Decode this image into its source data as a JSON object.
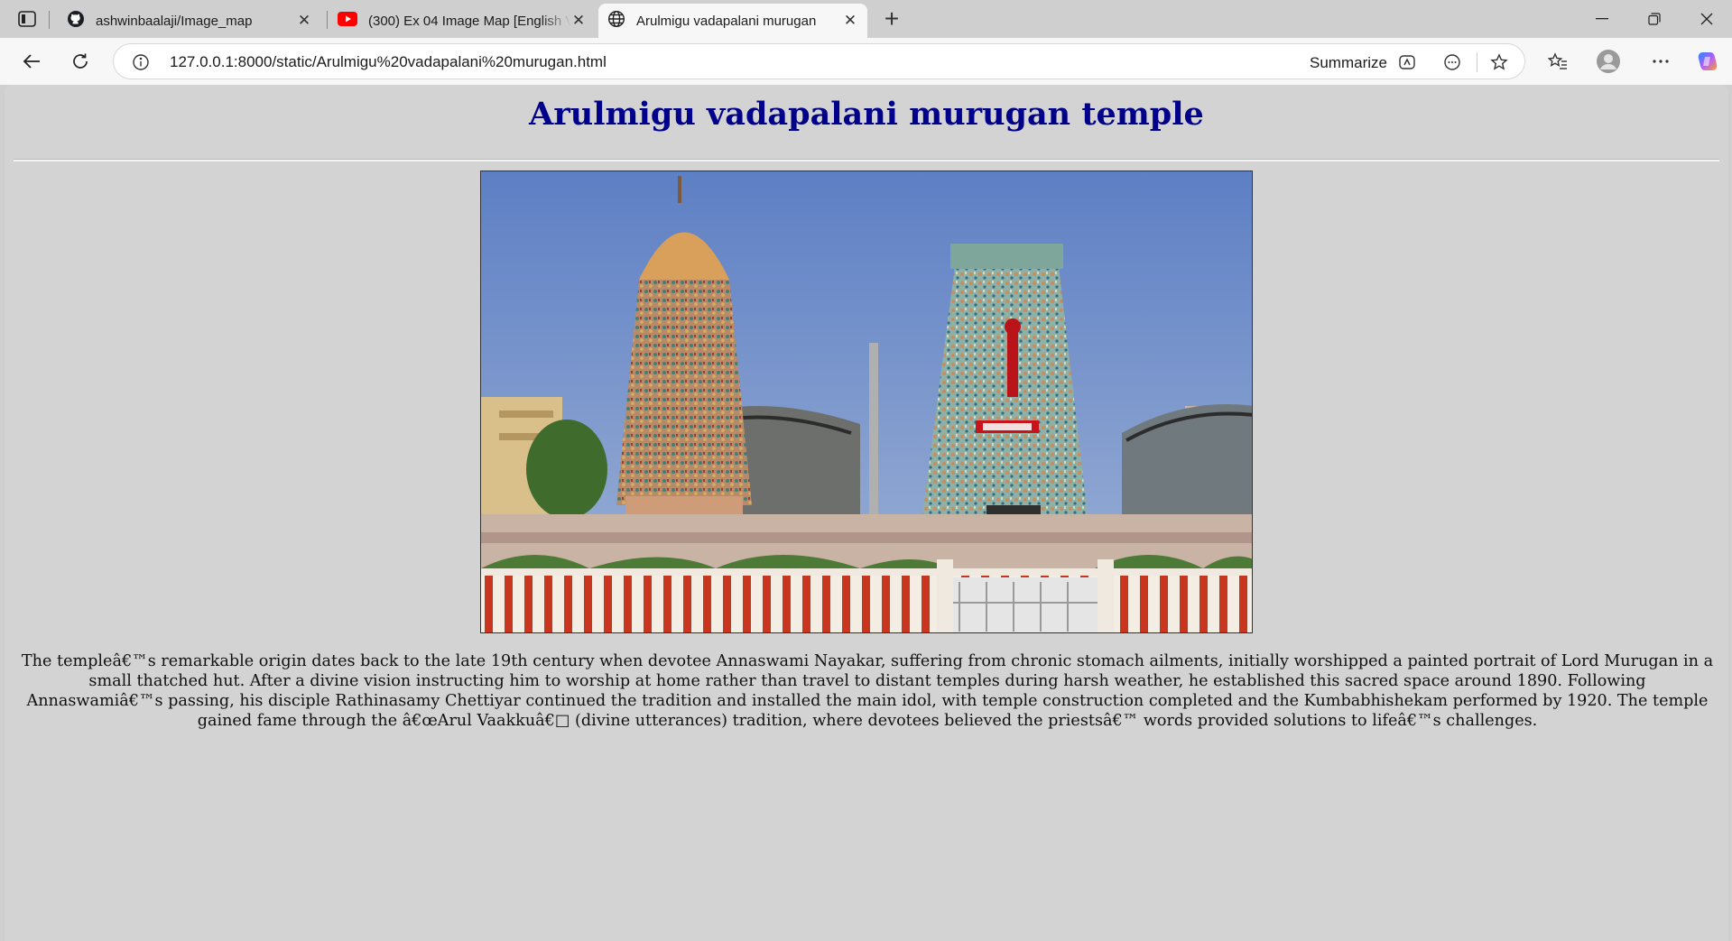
{
  "browser": {
    "tabs": [
      {
        "title": "ashwinbaalaji/Image_map",
        "icon": "github-icon"
      },
      {
        "title": "(300) Ex 04 Image Map [English Ve",
        "icon": "youtube-icon"
      },
      {
        "title": "Arulmigu vadapalani murugan",
        "icon": "globe-icon",
        "active": true
      }
    ],
    "url": "127.0.0.1:8000/static/Arulmigu%20vadapalani%20murugan.html",
    "summarize_label": "Summarize"
  },
  "page": {
    "title": "Arulmigu vadapalani murugan temple",
    "image_alt": "Arulmigu Vadapalani Murugan Temple gopurams",
    "description": "The templeâ€™s remarkable origin dates back to the late 19th century when devotee Annaswami Nayakar, suffering from chronic stomach ailments, initially worshipped a painted portrait of Lord Murugan in a small thatched hut. After a divine vision instructing him to worship at home rather than travel to distant temples during harsh weather, he established this sacred space around 1890. Following Annaswamiâ€™s passing, his disciple Rathinasamy Chettiyar continued the tradition and installed the main idol, with temple construction completed and the Kumbabhishekam performed by 1920. The temple gained fame through the â€œArul Vaakkuâ€□ (divine utterances) tradition, where devotees believed the priestsâ€™ words provided solutions to lifeâ€™s challenges."
  },
  "colors": {
    "title": "#00008b",
    "page_background": "#d3d3d3"
  }
}
